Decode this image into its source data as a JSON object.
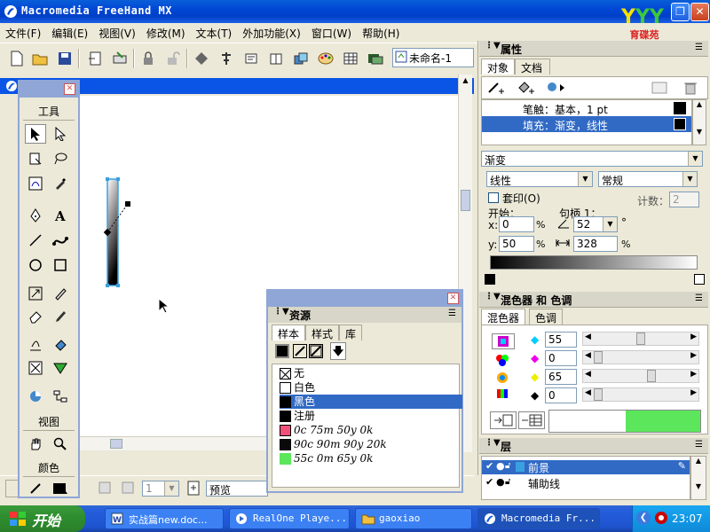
{
  "window": {
    "title": "Macromedia FreeHand MX",
    "logo_text": "育碟苑",
    "minimize": "_",
    "restore": "❐",
    "close": "✕"
  },
  "menu": [
    "文件(F)",
    "编辑(E)",
    "视图(V)",
    "修改(M)",
    "文本(T)",
    "外加功能(X)",
    "窗口(W)",
    "帮助(H)"
  ],
  "toolbar": {
    "doc_name": "未命名-1"
  },
  "tools": {
    "title": "工具",
    "view_label": "视图",
    "color_label": "颜色"
  },
  "status": {
    "preview": "预览",
    "page": "1"
  },
  "properties": {
    "title": "属性",
    "tabs": [
      "对象",
      "文档"
    ],
    "stroke": "笔触：基本，1 pt",
    "fill": "填充：渐变，线性",
    "fill_type": "渐变",
    "gradient_type": "线性",
    "gradient_mode": "常规",
    "overprint": "套印(O)",
    "count_label": "计数：",
    "count_value": "2",
    "start_label": "开始：",
    "handle_label": "句柄 1：",
    "x_label": "x:",
    "x_value": "0",
    "y_label": "y:",
    "y_value": "50",
    "angle_value": "52",
    "degree": "°",
    "length_value": "328",
    "percent": "%"
  },
  "mixer": {
    "title": "混色器 和 色调",
    "tabs": [
      "混色器",
      "色调"
    ],
    "c": "55",
    "m": "0",
    "y": "65",
    "k": "0",
    "swatch_color": "#5ce65c"
  },
  "layers": {
    "title": "层",
    "items": [
      "前景",
      "辅助线"
    ]
  },
  "assets": {
    "title": "资源",
    "tabs": [
      "样本",
      "样式",
      "库"
    ],
    "swatches": [
      {
        "name": "无",
        "color": "none"
      },
      {
        "name": "白色",
        "color": "#ffffff"
      },
      {
        "name": "黑色",
        "color": "#000000"
      },
      {
        "name": "注册",
        "color": "#000000"
      },
      {
        "name": "0c 75m 50y 0k",
        "color": "#f0507a"
      },
      {
        "name": "90c 90m 90y 20k",
        "color": "#0a0a0a"
      },
      {
        "name": "55c 0m 65y 0k",
        "color": "#5ce65c"
      }
    ]
  },
  "taskbar": {
    "start": "开始",
    "tasks": [
      "实战篇new.doc...",
      "RealOne Playe...",
      "gaoxiao",
      "Macromedia Fr..."
    ],
    "clock": "23:07"
  }
}
